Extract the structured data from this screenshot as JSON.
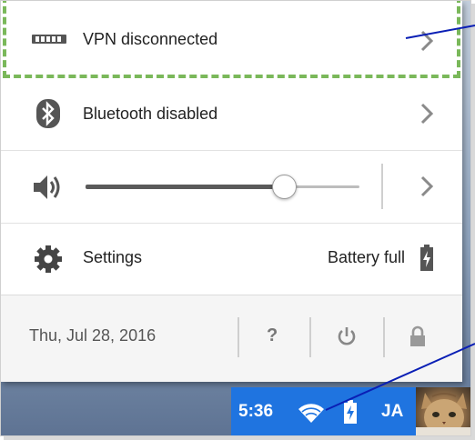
{
  "menu": {
    "vpn": {
      "label": "VPN disconnected",
      "icon": "vpn-icon"
    },
    "bluetooth": {
      "label": "Bluetooth disabled",
      "icon": "bluetooth-icon"
    },
    "volume": {
      "icon": "volume-icon",
      "level": 0.72
    },
    "settings": {
      "label": "Settings",
      "icon": "gear-icon"
    },
    "battery": {
      "label": "Battery full",
      "icon": "battery-icon"
    }
  },
  "footer": {
    "date": "Thu, Jul 28, 2016",
    "help_label": "?",
    "power_icon": "power-icon",
    "lock_icon": "lock-icon"
  },
  "shelf": {
    "time": "5:36",
    "initials": "JA",
    "wifi_icon": "wifi-icon",
    "battery_icon": "battery-charging-icon",
    "tray_color": "#1f74e0"
  },
  "annotation": {
    "color": "#0a1fb5",
    "dash_color": "#7ab85a"
  }
}
